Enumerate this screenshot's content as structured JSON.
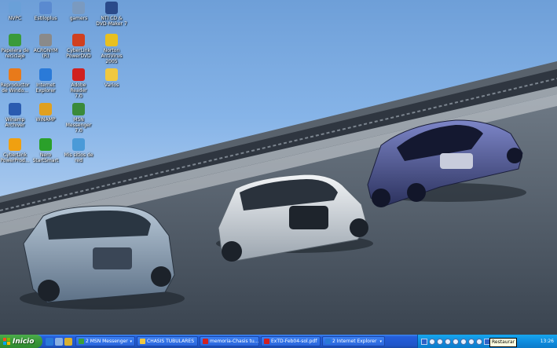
{
  "desktop_icons": [
    {
      "label": "NVPC",
      "icon": "pc-icon",
      "color": "#6aa0d8"
    },
    {
      "label": "Papelera de\nreciclaje",
      "icon": "recycle-bin-icon",
      "color": "#3a9a3a"
    },
    {
      "label": "Reproductor\nde Windo...",
      "icon": "media-player-icon",
      "color": "#e87a1a"
    },
    {
      "label": "Winamp\nArchiver",
      "icon": "winamp-icon",
      "color": "#2a5bb0"
    },
    {
      "label": "CyberLink\nPowerProd...",
      "icon": "powerproducer-icon",
      "color": "#f0a010"
    },
    {
      "label": "Estiloplus",
      "icon": "folder-app-icon",
      "color": "#5a8ad0"
    },
    {
      "label": "ACRONYM\n(R)",
      "icon": "network-icon",
      "color": "#8a8a8a"
    },
    {
      "label": "Internet\nExplorer",
      "icon": "internet-explorer-icon",
      "color": "#2a7ad8"
    },
    {
      "label": "WINAMP",
      "icon": "winamp-lightning-icon",
      "color": "#e0a020"
    },
    {
      "label": "Nero\nStartSmart",
      "icon": "nero-icon",
      "color": "#2aa02a"
    },
    {
      "label": "gamers",
      "icon": "gamers-icon",
      "color": "#7a9ac0"
    },
    {
      "label": "CyberLink\nPowerDVD",
      "icon": "powerdvd-icon",
      "color": "#d04020"
    },
    {
      "label": "Adobe Reader\n7.0",
      "icon": "adobe-reader-icon",
      "color": "#d02020"
    },
    {
      "label": "MSN\nMessenger 7.0",
      "icon": "msn-messenger-icon",
      "color": "#3a8a3a"
    },
    {
      "label": "Mis sitios de\nred",
      "icon": "network-places-icon",
      "color": "#4a9ad8"
    },
    {
      "label": "NTI CD &\nDVD-Maker 7",
      "icon": "nti-icon",
      "color": "#2a4a8a"
    },
    {
      "label": "Norton\nAntiVirus 2005",
      "icon": "norton-icon",
      "color": "#e8c020"
    },
    {
      "label": "Varios",
      "icon": "folder-icon",
      "color": "#f0c840"
    }
  ],
  "taskbar": {
    "start_label": "Inicio",
    "tasks": [
      {
        "label": "2 MSN Messenger",
        "icon": "msn-messenger-icon",
        "color": "#3aa03a",
        "has_arrow": true
      },
      {
        "label": "CHASIS TUBULARES",
        "icon": "folder-icon",
        "color": "#f0c840",
        "has_arrow": false
      },
      {
        "label": "memoria-Chasis tu...",
        "icon": "pdf-icon",
        "color": "#d02020",
        "has_arrow": false
      },
      {
        "label": "ExTD-Feb04-sol.pdf",
        "icon": "pdf-icon",
        "color": "#d02020",
        "has_arrow": false
      },
      {
        "label": "2 Internet Explorer",
        "icon": "internet-explorer-icon",
        "color": "#2a7ad8",
        "has_arrow": true
      }
    ],
    "clock": "13:26",
    "tooltip": "Restaurar"
  },
  "colors": {
    "taskbar": "#245edb",
    "start": "#3c9a3c",
    "tray": "#0f8ddf"
  }
}
